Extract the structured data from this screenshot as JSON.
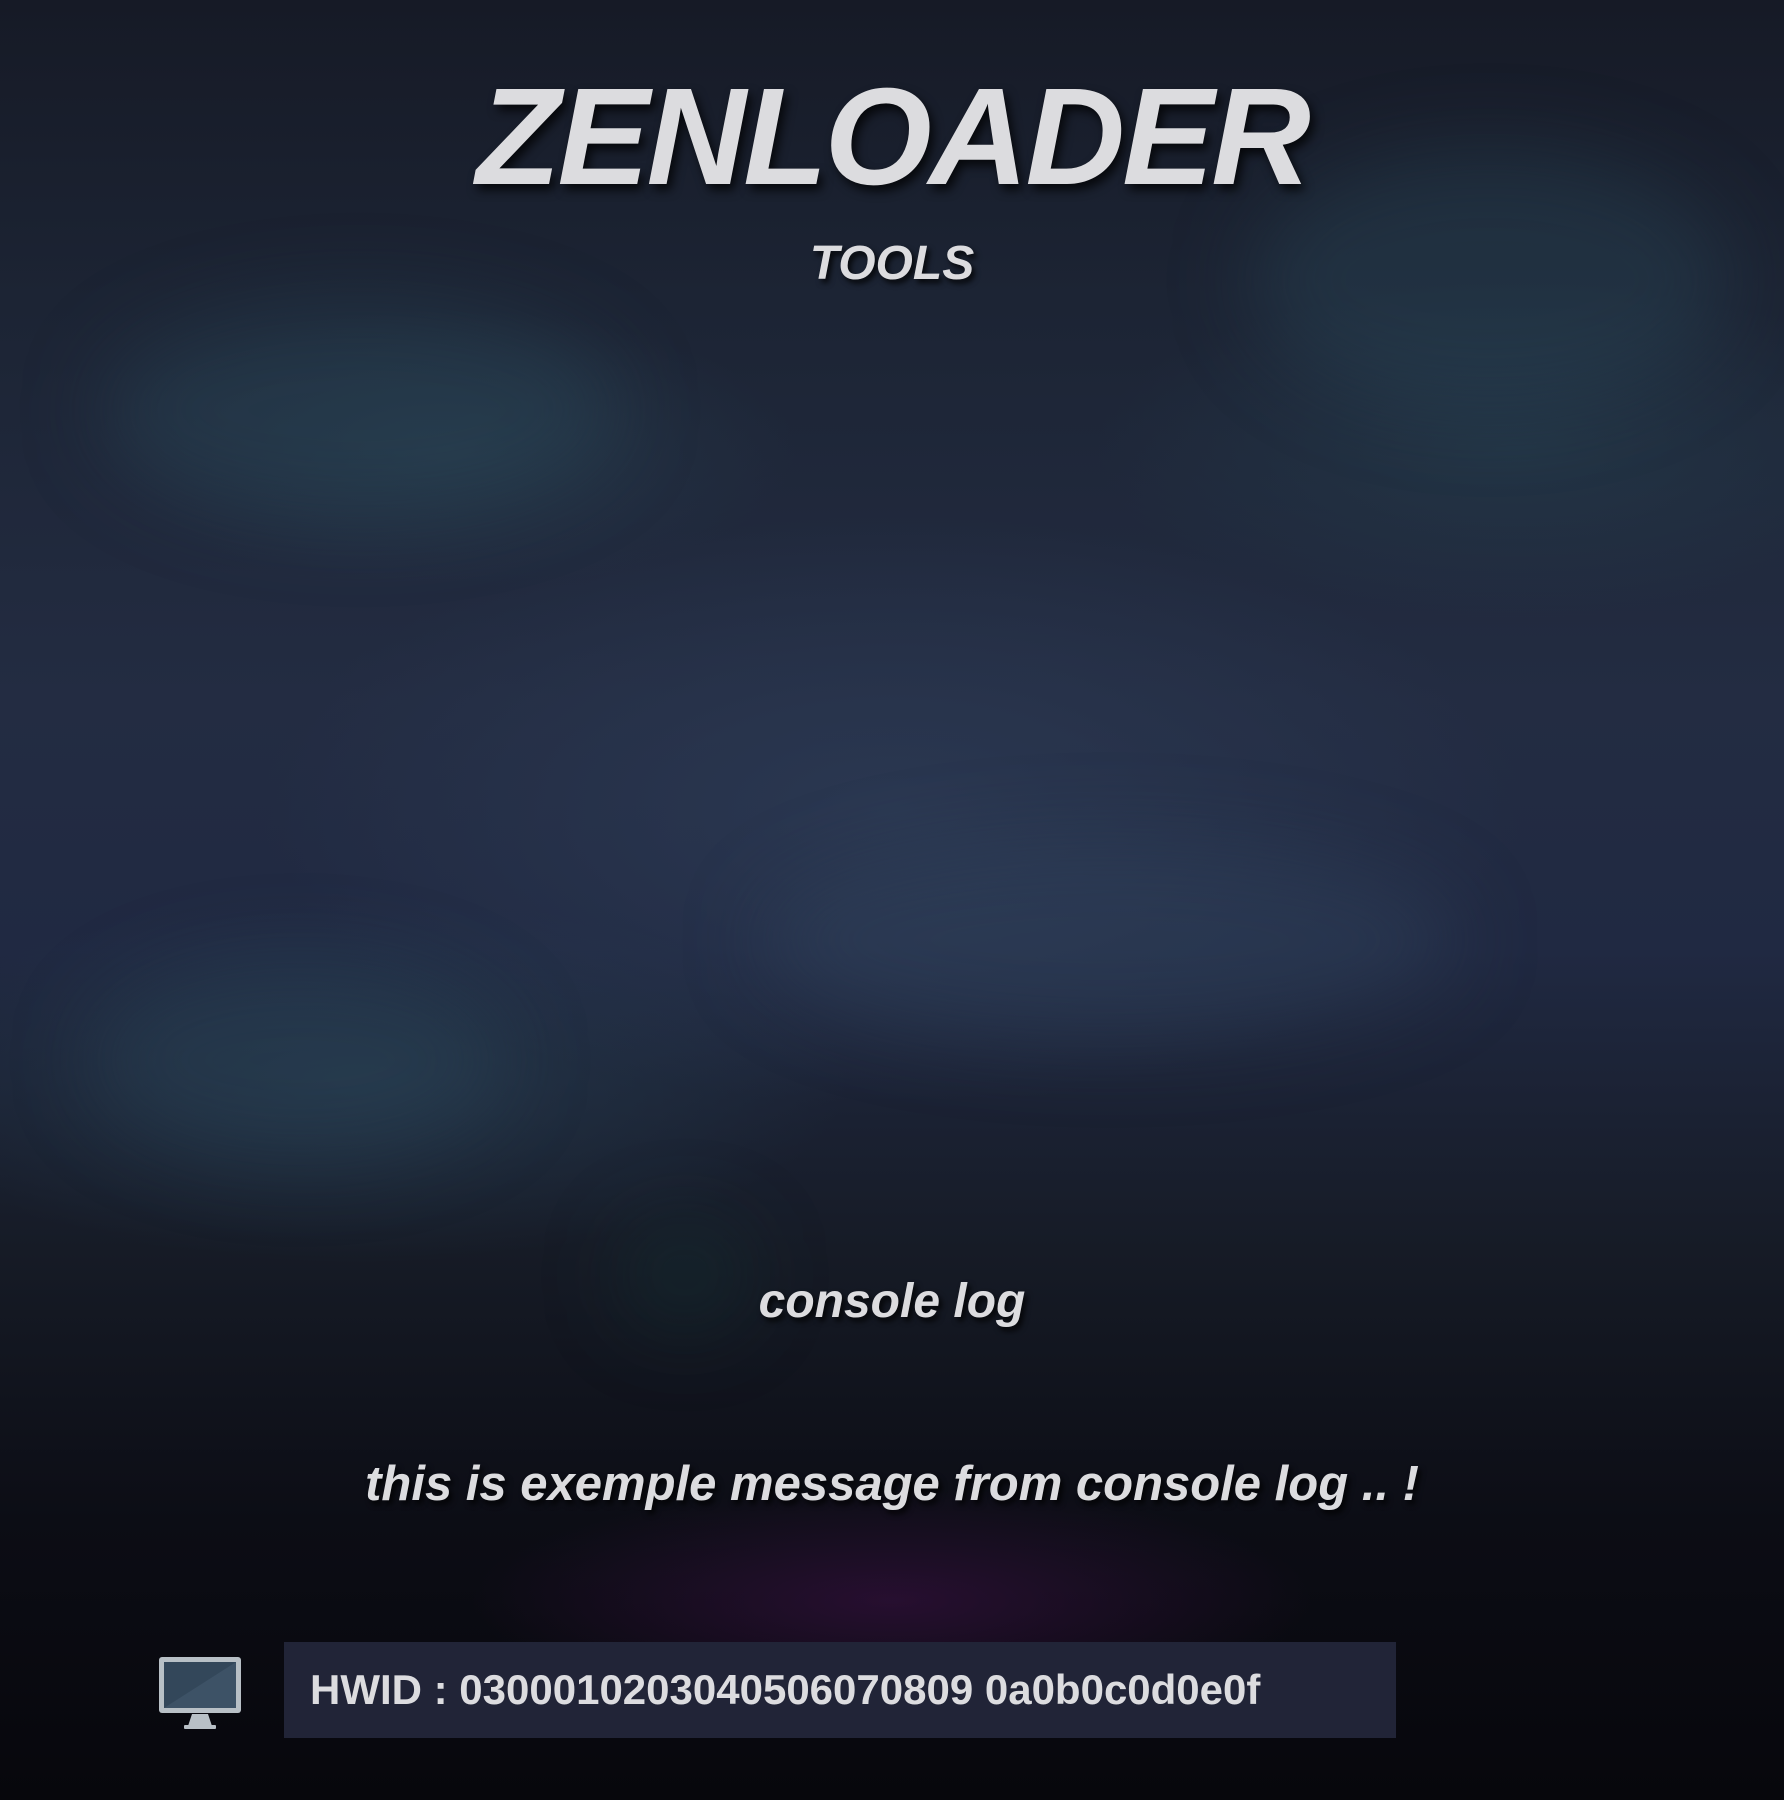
{
  "app": {
    "title": "ZENLOADER",
    "subtitle": "TOOLS"
  },
  "console": {
    "label": "console log",
    "message": "this is exemple message from console log .. !"
  },
  "footer": {
    "icon": "monitor-icon",
    "hwid_text": "HWID : 0300010203040506070809 0a0b0c0d0e0f"
  },
  "colors": {
    "text": "#dcdcdf",
    "hwid_box": "#212437",
    "background_top": "#161a26",
    "background_bottom": "#07070c"
  }
}
